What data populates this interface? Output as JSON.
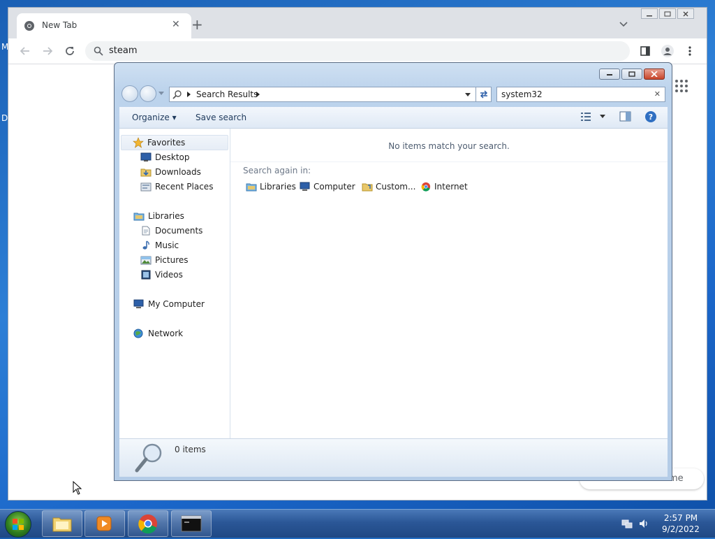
{
  "desktop": {
    "fragments": [
      "M",
      "D"
    ]
  },
  "chrome": {
    "tab": {
      "title": "New Tab"
    },
    "omnibox": {
      "text": "steam"
    },
    "bottom_pill": "me"
  },
  "explorer": {
    "address": {
      "crumb": "Search Results"
    },
    "search": {
      "value": "system32"
    },
    "commands": {
      "organize": "Organize",
      "save_search": "Save search"
    },
    "nav": {
      "favorites": "Favorites",
      "desktop": "Desktop",
      "downloads": "Downloads",
      "recent": "Recent Places",
      "libraries": "Libraries",
      "documents": "Documents",
      "music": "Music",
      "pictures": "Pictures",
      "videos": "Videos",
      "computer": "My Computer",
      "network": "Network"
    },
    "content": {
      "no_items": "No items match your search.",
      "search_again": "Search again in:",
      "locations": [
        "Libraries",
        "Computer",
        "Custom...",
        "Internet"
      ]
    },
    "details": {
      "count": "0 items"
    }
  },
  "taskbar": {
    "time": "2:57 PM",
    "date": "9/2/2022"
  }
}
